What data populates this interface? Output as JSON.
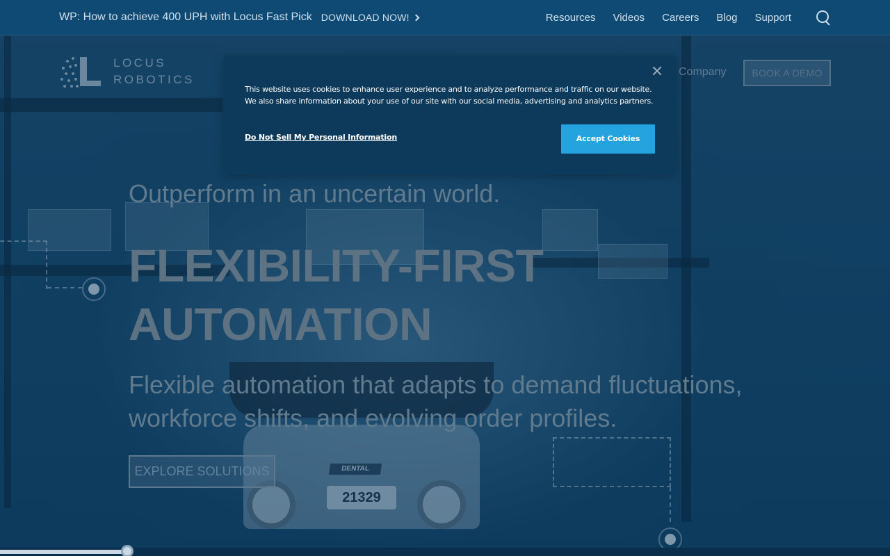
{
  "topbar": {
    "promo_text": "WP: How to achieve 400 UPH with Locus Fast Pick",
    "promo_cta": "DOWNLOAD NOW!",
    "links": [
      "Resources",
      "Videos",
      "Careers",
      "Blog",
      "Support"
    ],
    "search_icon": "search-icon"
  },
  "header": {
    "logo_line1": "LOCUS",
    "logo_line2": "ROBOTICS",
    "nav_company": "Company",
    "book_demo": "BOOK A DEMO"
  },
  "hero": {
    "tagline": "Outperform in an uncertain world.",
    "headline_line1": "FLEXIBILITY-FIRST",
    "headline_line2": "AUTOMATION",
    "subhead": "Flexible automation that adapts to demand fluctuations, workforce shifts, and evolving order profiles.",
    "cta": "EXPLORE SOLUTIONS",
    "robot_number": "21329",
    "robot_tag": "DENTAL"
  },
  "cookie_banner": {
    "message": "This website uses cookies to enhance user experience and to analyze performance and traffic on our website. We also share information about your use of our site with our social media, advertising and analytics partners.",
    "link": "Do Not Sell My Personal Information",
    "accept": "Accept Cookies"
  },
  "colors": {
    "accent": "#24a3de",
    "topbar": "#0e4a73",
    "dialog": "#0d3a5a"
  }
}
